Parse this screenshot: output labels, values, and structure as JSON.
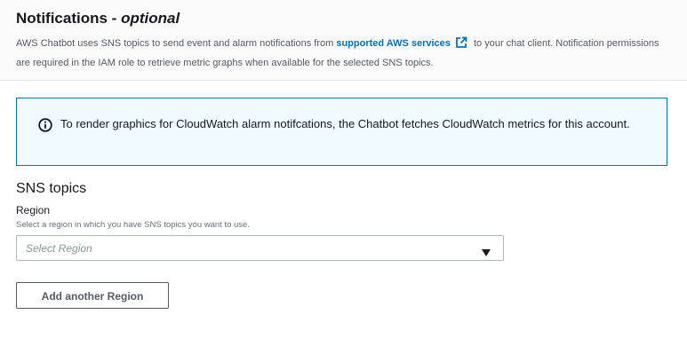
{
  "section": {
    "title": "Notifications - ",
    "title_suffix": "optional",
    "description_before_link": "AWS Chatbot uses SNS topics to send event and alarm notifications from ",
    "link_text": "supported AWS services",
    "description_after_link": " to your chat client. Notification permissions are required in the IAM role to retrieve metric graphs when available for the selected SNS topics."
  },
  "info": {
    "text": "To render graphics for CloudWatch alarm notifcations, the Chatbot fetches CloudWatch metrics for this account.",
    "icon": "info-icon"
  },
  "sns": {
    "title": "SNS topics",
    "region_label": "Region",
    "region_description": "Select a region in which you have SNS topics you want to use.",
    "region_placeholder": "Select Region",
    "add_region_button": "Add another Region"
  },
  "colors": {
    "link": "#0073bb",
    "info_border": "#0073bb",
    "info_background": "#f1faff",
    "header_background": "#fafafa"
  }
}
